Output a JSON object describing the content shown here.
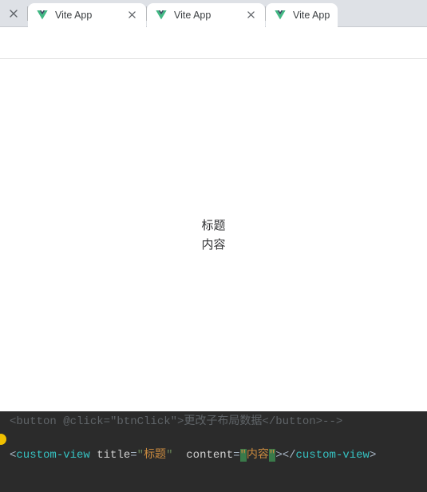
{
  "tabs": [
    {
      "title": "Vite App"
    },
    {
      "title": "Vite App"
    },
    {
      "title": "Vite App"
    }
  ],
  "page": {
    "title": "标题",
    "content": "内容"
  },
  "editor": {
    "comment_line": "<button @click=\"btnClick\">更改子布局数据</button>-->",
    "tag": "custom-view",
    "attr_title": "title",
    "val_title": "标题",
    "attr_content": "content",
    "val_content": "内容",
    "eq": "=",
    "lt": "<",
    "gt": ">",
    "slash": "/"
  }
}
